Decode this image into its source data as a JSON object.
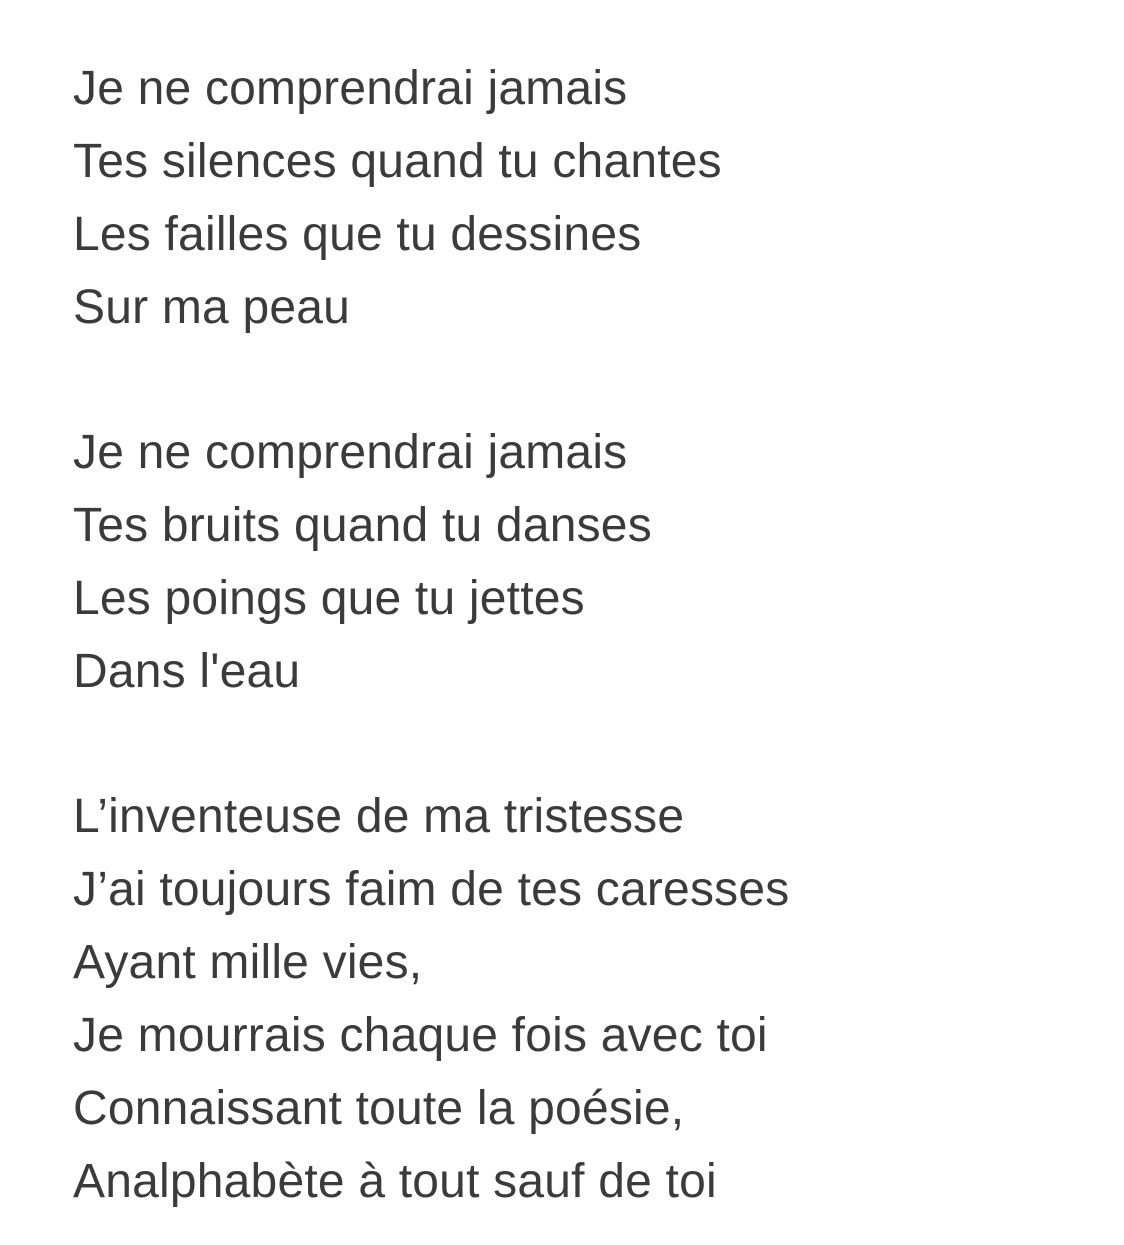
{
  "poem": {
    "stanzas": [
      {
        "lines": [
          "Je ne comprendrai jamais",
          "Tes silences quand tu chantes",
          "Les failles que tu dessines",
          "Sur ma peau"
        ]
      },
      {
        "lines": [
          "Je ne comprendrai jamais",
          "Tes bruits quand tu danses",
          "Les poings que tu jettes",
          "Dans l'eau"
        ]
      },
      {
        "lines": [
          "L’inventeuse de ma tristesse",
          "J’ai toujours faim de tes caresses",
          "Ayant mille vies,",
          "Je mourrais chaque fois avec toi",
          "Connaissant toute la poésie,",
          "Analphabète à tout sauf de toi"
        ]
      }
    ]
  }
}
